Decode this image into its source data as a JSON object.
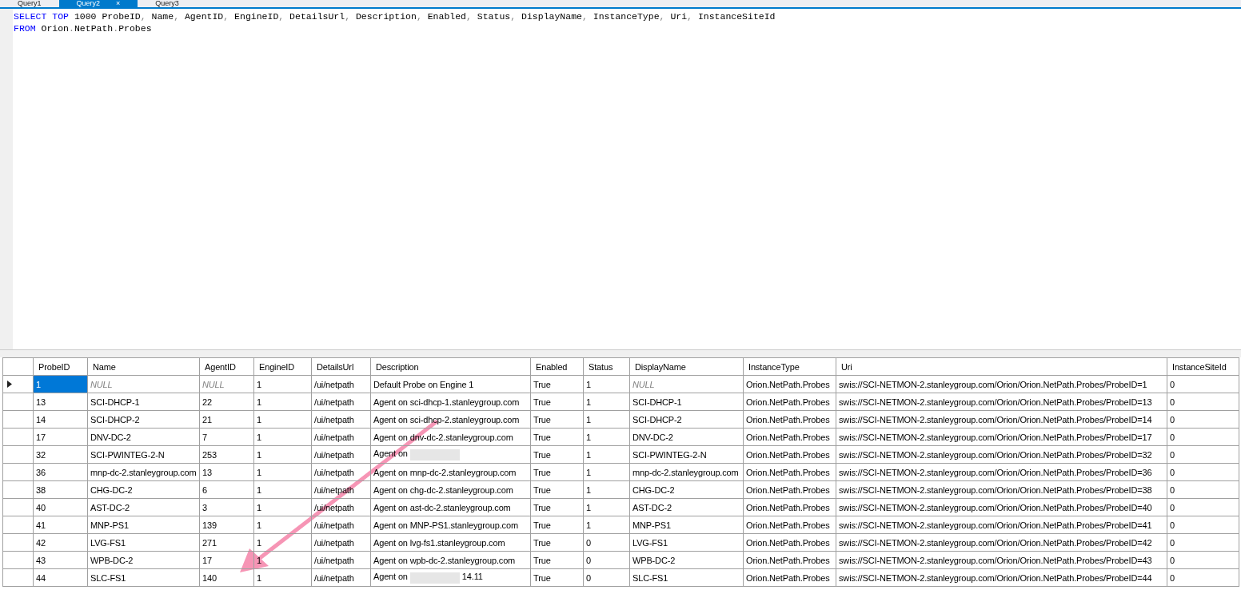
{
  "tabs": [
    {
      "label": "Query1",
      "selected": false
    },
    {
      "label": "Query2",
      "selected": true,
      "close": "×"
    },
    {
      "label": "Query3",
      "selected": false
    }
  ],
  "editor": {
    "lines": [
      [
        {
          "t": "SELECT TOP",
          "kind": "keyword"
        },
        {
          "t": " 1000 ProbeID",
          "kind": "plain"
        },
        {
          "t": ",",
          "kind": "punct"
        },
        {
          "t": " Name",
          "kind": "plain"
        },
        {
          "t": ",",
          "kind": "punct"
        },
        {
          "t": " AgentID",
          "kind": "plain"
        },
        {
          "t": ",",
          "kind": "punct"
        },
        {
          "t": " EngineID",
          "kind": "plain"
        },
        {
          "t": ",",
          "kind": "punct"
        },
        {
          "t": " DetailsUrl",
          "kind": "plain"
        },
        {
          "t": ",",
          "kind": "punct"
        },
        {
          "t": " Description",
          "kind": "plain"
        },
        {
          "t": ",",
          "kind": "punct"
        },
        {
          "t": " Enabled",
          "kind": "plain"
        },
        {
          "t": ",",
          "kind": "punct"
        },
        {
          "t": " Status",
          "kind": "plain"
        },
        {
          "t": ",",
          "kind": "punct"
        },
        {
          "t": " DisplayName",
          "kind": "plain"
        },
        {
          "t": ",",
          "kind": "punct"
        },
        {
          "t": " InstanceType",
          "kind": "plain"
        },
        {
          "t": ",",
          "kind": "punct"
        },
        {
          "t": " Uri",
          "kind": "plain"
        },
        {
          "t": ",",
          "kind": "punct"
        },
        {
          "t": " InstanceSiteId",
          "kind": "plain"
        }
      ],
      [
        {
          "t": "FROM",
          "kind": "keyword"
        },
        {
          "t": " Orion",
          "kind": "plain"
        },
        {
          "t": ".",
          "kind": "punct"
        },
        {
          "t": "NetPath",
          "kind": "plain"
        },
        {
          "t": ".",
          "kind": "punct"
        },
        {
          "t": "Probes",
          "kind": "plain"
        }
      ]
    ]
  },
  "results": {
    "columns": [
      "ProbeID",
      "Name",
      "AgentID",
      "EngineID",
      "DetailsUrl",
      "Description",
      "Enabled",
      "Status",
      "DisplayName",
      "InstanceType",
      "Uri",
      "InstanceSiteId"
    ],
    "rows": [
      {
        "selected": true,
        "cells": [
          "1",
          {
            "kind": "null",
            "text": "NULL"
          },
          {
            "kind": "null",
            "text": "NULL"
          },
          "1",
          "/ui/netpath",
          "Default Probe on Engine 1",
          "True",
          "1",
          {
            "kind": "null",
            "text": "NULL"
          },
          "Orion.NetPath.Probes",
          "swis://SCI-NETMON-2.stanleygroup.com/Orion/Orion.NetPath.Probes/ProbeID=1",
          "0"
        ]
      },
      {
        "selected": false,
        "cells": [
          "13",
          "SCI-DHCP-1",
          "22",
          "1",
          "/ui/netpath",
          "Agent on sci-dhcp-1.stanleygroup.com",
          "True",
          "1",
          "SCI-DHCP-1",
          "Orion.NetPath.Probes",
          "swis://SCI-NETMON-2.stanleygroup.com/Orion/Orion.NetPath.Probes/ProbeID=13",
          "0"
        ]
      },
      {
        "selected": false,
        "cells": [
          "14",
          "SCI-DHCP-2",
          "21",
          "1",
          "/ui/netpath",
          "Agent on sci-dhcp-2.stanleygroup.com",
          "True",
          "1",
          "SCI-DHCP-2",
          "Orion.NetPath.Probes",
          "swis://SCI-NETMON-2.stanleygroup.com/Orion/Orion.NetPath.Probes/ProbeID=14",
          "0"
        ]
      },
      {
        "selected": false,
        "cells": [
          "17",
          "DNV-DC-2",
          "7",
          "1",
          "/ui/netpath",
          "Agent on dnv-dc-2.stanleygroup.com",
          "True",
          "1",
          "DNV-DC-2",
          "Orion.NetPath.Probes",
          "swis://SCI-NETMON-2.stanleygroup.com/Orion/Orion.NetPath.Probes/ProbeID=17",
          "0"
        ]
      },
      {
        "selected": false,
        "cells": [
          "32",
          "SCI-PWINTEG-2-N",
          "253",
          "1",
          "/ui/netpath",
          {
            "kind": "redacted",
            "before": "Agent on"
          },
          "True",
          "1",
          "SCI-PWINTEG-2-N",
          "Orion.NetPath.Probes",
          "swis://SCI-NETMON-2.stanleygroup.com/Orion/Orion.NetPath.Probes/ProbeID=32",
          "0"
        ]
      },
      {
        "selected": false,
        "cells": [
          "36",
          "mnp-dc-2.stanleygroup.com",
          "13",
          "1",
          "/ui/netpath",
          "Agent on mnp-dc-2.stanleygroup.com",
          "True",
          "1",
          "mnp-dc-2.stanleygroup.com",
          "Orion.NetPath.Probes",
          "swis://SCI-NETMON-2.stanleygroup.com/Orion/Orion.NetPath.Probes/ProbeID=36",
          "0"
        ]
      },
      {
        "selected": false,
        "cells": [
          "38",
          "CHG-DC-2",
          "6",
          "1",
          "/ui/netpath",
          "Agent on chg-dc-2.stanleygroup.com",
          "True",
          "1",
          "CHG-DC-2",
          "Orion.NetPath.Probes",
          "swis://SCI-NETMON-2.stanleygroup.com/Orion/Orion.NetPath.Probes/ProbeID=38",
          "0"
        ]
      },
      {
        "selected": false,
        "cells": [
          "40",
          "AST-DC-2",
          "3",
          "1",
          "/ui/netpath",
          "Agent on ast-dc-2.stanleygroup.com",
          "True",
          "1",
          "AST-DC-2",
          "Orion.NetPath.Probes",
          "swis://SCI-NETMON-2.stanleygroup.com/Orion/Orion.NetPath.Probes/ProbeID=40",
          "0"
        ]
      },
      {
        "selected": false,
        "cells": [
          "41",
          "MNP-PS1",
          "139",
          "1",
          "/ui/netpath",
          "Agent on MNP-PS1.stanleygroup.com",
          "True",
          "1",
          "MNP-PS1",
          "Orion.NetPath.Probes",
          "swis://SCI-NETMON-2.stanleygroup.com/Orion/Orion.NetPath.Probes/ProbeID=41",
          "0"
        ]
      },
      {
        "selected": false,
        "cells": [
          "42",
          "LVG-FS1",
          "271",
          "1",
          "/ui/netpath",
          "Agent on lvg-fs1.stanleygroup.com",
          "True",
          "0",
          "LVG-FS1",
          "Orion.NetPath.Probes",
          "swis://SCI-NETMON-2.stanleygroup.com/Orion/Orion.NetPath.Probes/ProbeID=42",
          "0"
        ]
      },
      {
        "selected": false,
        "cells": [
          "43",
          "WPB-DC-2",
          "17",
          "1",
          "/ui/netpath",
          "Agent on wpb-dc-2.stanleygroup.com",
          "True",
          "0",
          "WPB-DC-2",
          "Orion.NetPath.Probes",
          "swis://SCI-NETMON-2.stanleygroup.com/Orion/Orion.NetPath.Probes/ProbeID=43",
          "0"
        ]
      },
      {
        "selected": false,
        "cells": [
          "44",
          "SLC-FS1",
          "140",
          "1",
          "/ui/netpath",
          {
            "kind": "redacted",
            "before": "Agent on",
            "after": "14.11"
          },
          "True",
          "0",
          "SLC-FS1",
          "Orion.NetPath.Probes",
          "swis://SCI-NETMON-2.stanleygroup.com/Orion/Orion.NetPath.Probes/ProbeID=44",
          "0"
        ]
      }
    ]
  }
}
